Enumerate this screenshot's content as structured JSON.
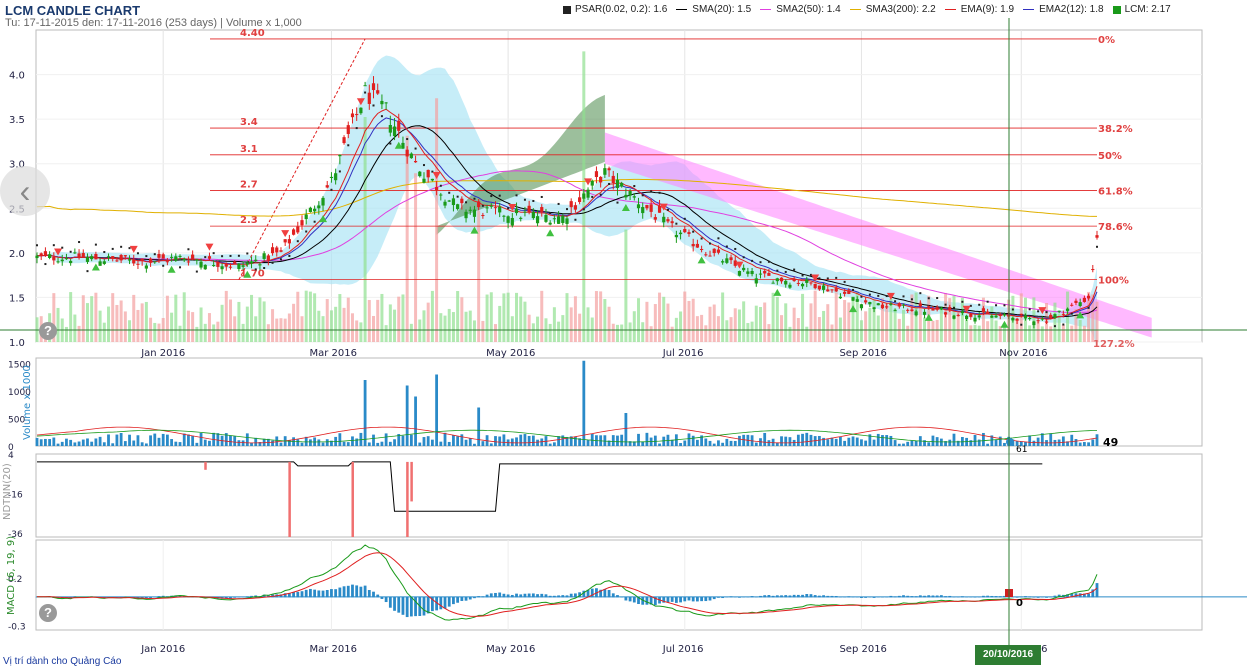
{
  "header": {
    "title": "LCM CANDLE CHART",
    "subtitle": "Tu: 17-11-2015 den: 17-11-2016 (253 days) | Volume x 1,000"
  },
  "legend": [
    {
      "label": "PSAR(0.02, 0.2): 1.6",
      "color": "#222222",
      "kind": "square"
    },
    {
      "label": "SMA(20): 1.5",
      "color": "#000000",
      "kind": "line"
    },
    {
      "label": "SMA2(50): 1.4",
      "color": "#e040e0",
      "kind": "line"
    },
    {
      "label": "SMA3(200): 2.2",
      "color": "#e0b000",
      "kind": "line"
    },
    {
      "label": "EMA(9): 1.9",
      "color": "#e02020",
      "kind": "line"
    },
    {
      "label": "EMA2(12): 1.8",
      "color": "#3030c0",
      "kind": "line"
    },
    {
      "label": "LCM: 2.17",
      "color": "#1a9a1a",
      "kind": "square"
    }
  ],
  "footer": {
    "ad_text": "Vị trí dành cho Quảng Cáo",
    "cursor_date": "20/10/2016"
  },
  "colors": {
    "up": "#1a9a1a",
    "down": "#e02020",
    "cloud_green": "#4a8a4a",
    "cloud_pink": "#ff80ff",
    "band": "#a8e4f4",
    "macd_hist": "#2a8ac8"
  },
  "chart_data": [
    {
      "type": "candlestick",
      "name": "price",
      "x_ticks": [
        "Jan 2016",
        "Mar 2016",
        "May 2016",
        "Jul 2016",
        "Sep 2016",
        "Nov 2016"
      ],
      "y_ticks": [
        "1.0",
        "1.5",
        "2.0",
        "2.5",
        "3.0",
        "3.5",
        "4.0"
      ],
      "ylim": [
        1.0,
        4.5
      ],
      "close_anchors": [
        [
          0,
          1.95
        ],
        [
          10,
          1.95
        ],
        [
          25,
          1.9
        ],
        [
          35,
          1.95
        ],
        [
          48,
          1.85
        ],
        [
          58,
          2.0
        ],
        [
          70,
          2.8
        ],
        [
          78,
          3.8
        ],
        [
          83,
          3.6
        ],
        [
          90,
          3.0
        ],
        [
          100,
          2.5
        ],
        [
          110,
          2.45
        ],
        [
          125,
          2.4
        ],
        [
          135,
          2.9
        ],
        [
          140,
          2.7
        ],
        [
          150,
          2.3
        ],
        [
          160,
          2.0
        ],
        [
          170,
          1.75
        ],
        [
          185,
          1.65
        ],
        [
          200,
          1.4
        ],
        [
          215,
          1.35
        ],
        [
          225,
          1.3
        ],
        [
          240,
          1.25
        ],
        [
          250,
          1.5
        ],
        [
          252,
          2.17
        ]
      ],
      "fibonacci": {
        "high": 4.4,
        "low": 1.7,
        "levels": [
          {
            "price": "4.40",
            "pct": "0%"
          },
          {
            "price": "3.4",
            "pct": "38.2%"
          },
          {
            "price": "3.1",
            "pct": "50%"
          },
          {
            "price": "2.7",
            "pct": "61.8%"
          },
          {
            "price": "2.3",
            "pct": "78.6%"
          },
          {
            "price": "1.70",
            "pct": "100%"
          }
        ],
        "extension_label": "127.2%"
      }
    },
    {
      "type": "bar",
      "name": "Volume x 1000",
      "ylabel": "Volume x 1000",
      "y_ticks": [
        "0",
        "500",
        "1000",
        "1500"
      ],
      "ylim": [
        0,
        1600
      ],
      "spikes": [
        [
          78,
          1200
        ],
        [
          88,
          1100
        ],
        [
          95,
          1300
        ],
        [
          90,
          900
        ],
        [
          105,
          700
        ],
        [
          130,
          1550
        ],
        [
          140,
          600
        ]
      ],
      "last_label": "49",
      "cursor_label": "61"
    },
    {
      "type": "line",
      "name": "NDTNN(20)",
      "ylabel": "NDTNN(20)",
      "y_ticks": [
        "4",
        "-16",
        "-36"
      ],
      "ylim": [
        -38,
        4
      ]
    },
    {
      "type": "line",
      "name": "MACD (6, 19, 9)",
      "ylabel": "MACD (6, 19, 9)",
      "y_ticks": [
        "0.2",
        "-0.3"
      ],
      "ylim": [
        -0.35,
        0.6
      ],
      "cursor_label": "0"
    }
  ]
}
